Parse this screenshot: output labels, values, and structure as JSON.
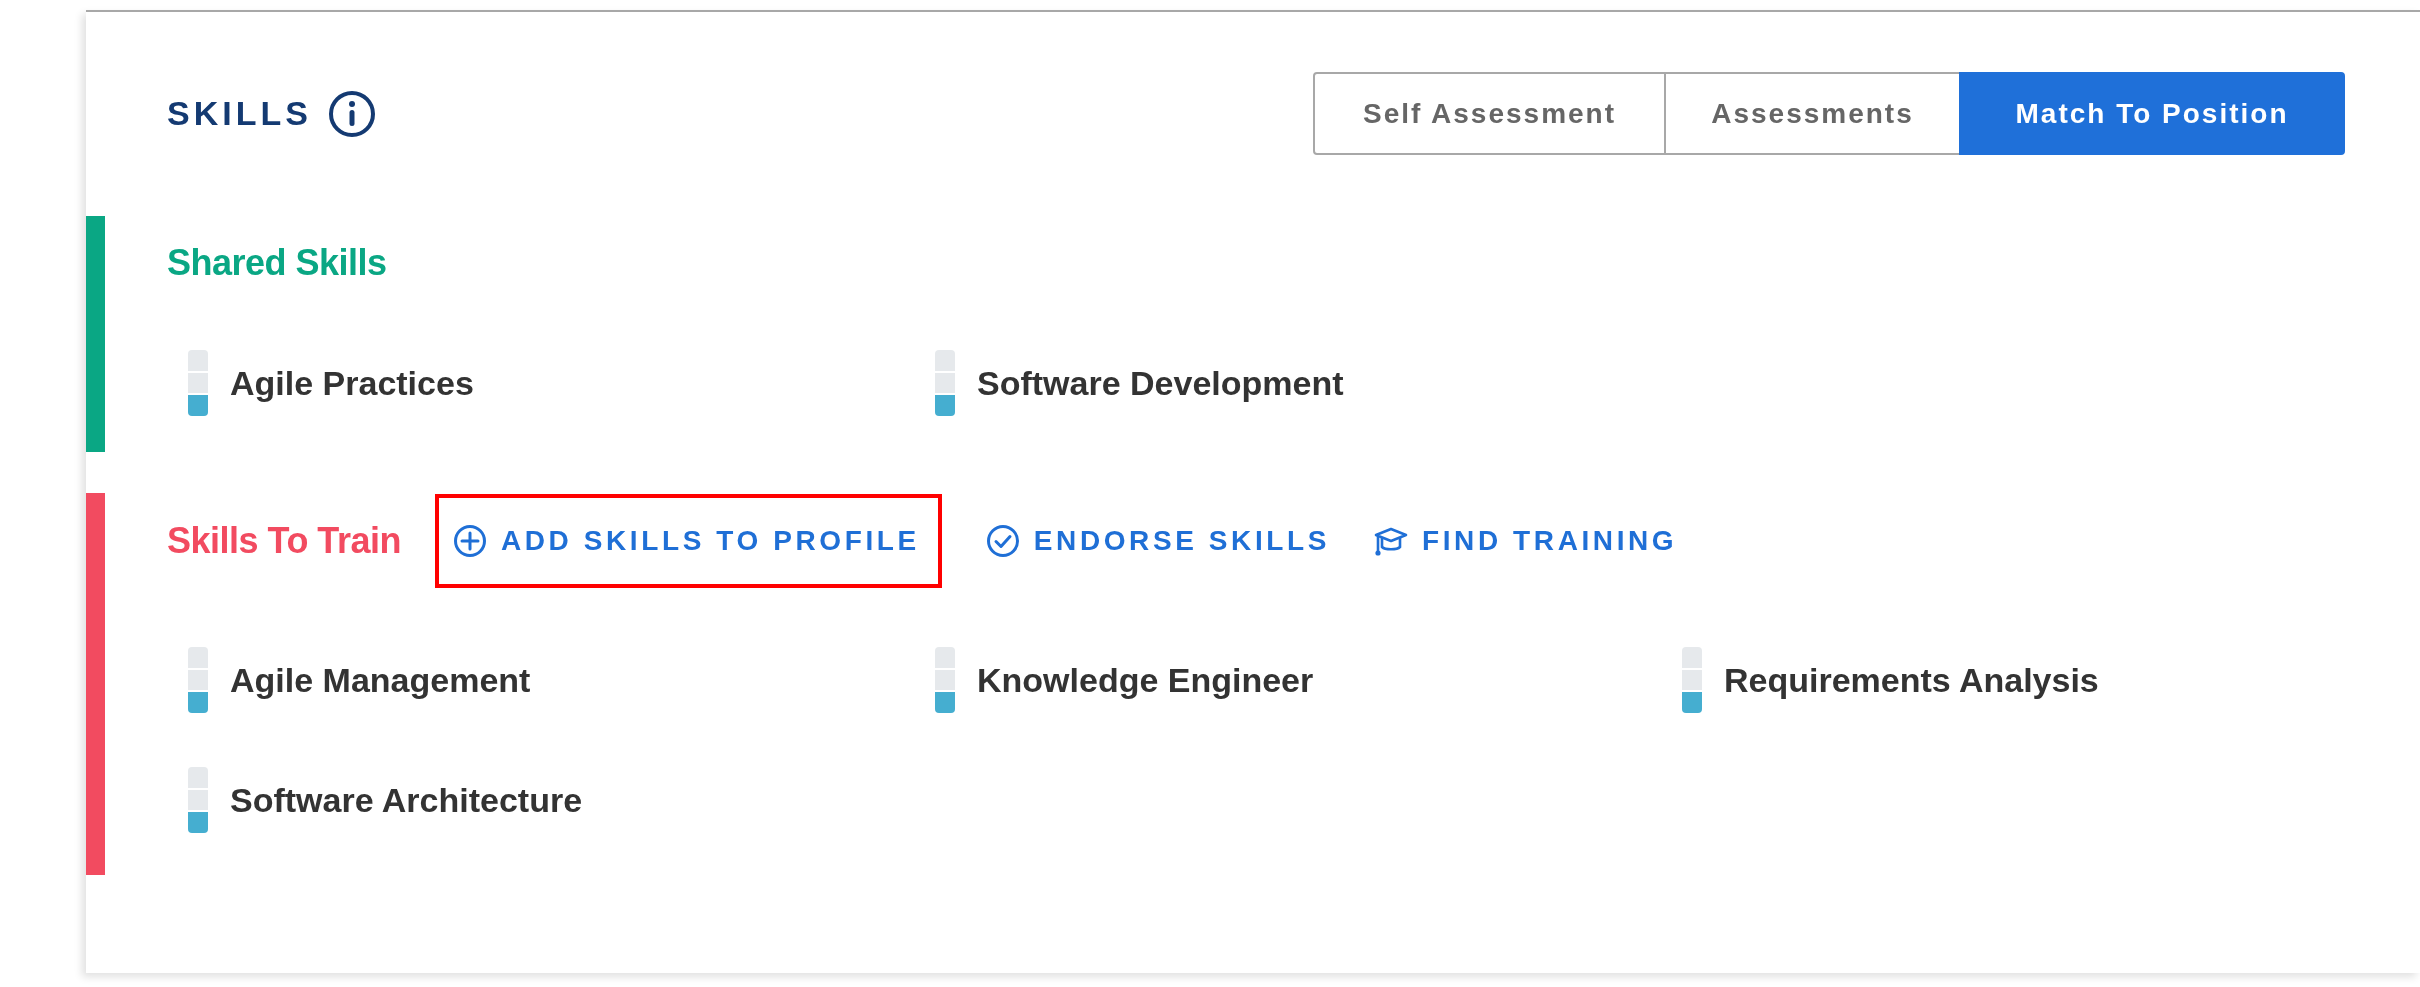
{
  "title": "SKILLS",
  "tabs": [
    {
      "label": "Self Assessment",
      "selected": false
    },
    {
      "label": "Assessments",
      "selected": false
    },
    {
      "label": "Match To Position",
      "selected": true
    }
  ],
  "sections": [
    {
      "heading": "Shared Skills",
      "color": "#0aa784",
      "skills": [
        {
          "name": "Agile Practices",
          "level": 0.33
        },
        {
          "name": "Software Development",
          "level": 0.33
        }
      ]
    },
    {
      "heading": "Skills To Train",
      "color": "#f24b60",
      "actions": [
        {
          "kind": "add",
          "label": "ADD SKILLS TO PROFILE",
          "highlighted": true
        },
        {
          "kind": "endorse",
          "label": "ENDORSE SKILLS",
          "highlighted": false
        },
        {
          "kind": "training",
          "label": "FIND TRAINING",
          "highlighted": false
        }
      ],
      "skills": [
        {
          "name": "Agile Management",
          "level": 0.33
        },
        {
          "name": "Knowledge Engineer",
          "level": 0.33
        },
        {
          "name": "Requirements Analysis",
          "level": 0.33
        },
        {
          "name": "Software Architecture",
          "level": 0.33
        }
      ]
    }
  ]
}
